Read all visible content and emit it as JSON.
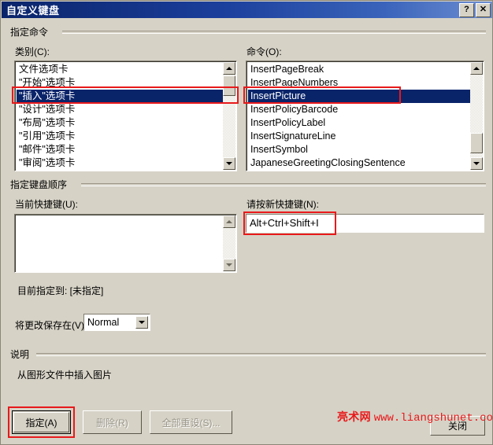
{
  "window": {
    "title": "自定义键盘",
    "help_button": "?",
    "close_button": "✕"
  },
  "groups": {
    "specify_command": "指定命令",
    "specify_keyboard_sequence": "指定键盘顺序",
    "description": "说明"
  },
  "labels": {
    "category": "类别(C):",
    "commands": "命令(O):",
    "current_shortcuts": "当前快捷键(U):",
    "press_new_shortcut": "请按新快捷键(N):",
    "currently_assigned_to": "目前指定到: [未指定]",
    "save_changes_in": "将更改保存在(V):"
  },
  "category_list": {
    "items": [
      "文件选项卡",
      "\"开始\"选项卡",
      "\"插入\"选项卡",
      "\"设计\"选项卡",
      "\"布局\"选项卡",
      "\"引用\"选项卡",
      "\"邮件\"选项卡",
      "\"审阅\"选项卡"
    ],
    "selected_index": 2,
    "selected_value": "\"插入\"选项卡"
  },
  "command_list": {
    "items": [
      "InsertPageBreak",
      "InsertPageNumbers",
      "InsertPicture",
      "InsertPolicyBarcode",
      "InsertPolicyLabel",
      "InsertSignatureLine",
      "InsertSymbol",
      "JapaneseGreetingClosingSentence"
    ],
    "selected_index": 2,
    "selected_value": "InsertPicture"
  },
  "current_shortcuts_box": {
    "value": ""
  },
  "new_shortcut_input": {
    "value": "Alt+Ctrl+Shift+I",
    "placeholder": ""
  },
  "save_in_combo": {
    "value": "Normal",
    "options": [
      "Normal"
    ]
  },
  "description_text": "从图形文件中插入图片",
  "buttons": {
    "assign": "指定(A)",
    "remove": "删除(R)",
    "reset_all": "全部重设(S)...",
    "close": "关闭"
  },
  "watermark": {
    "cn": "亮术网",
    "en": "www.liangshunet.com"
  },
  "colors": {
    "dialog_face": "#d6d2c6",
    "title_bar_start": "#0a246a",
    "selection_blue": "#0a246a",
    "annotation_red": "#e8191b",
    "watermark_red": "#e8191b"
  }
}
